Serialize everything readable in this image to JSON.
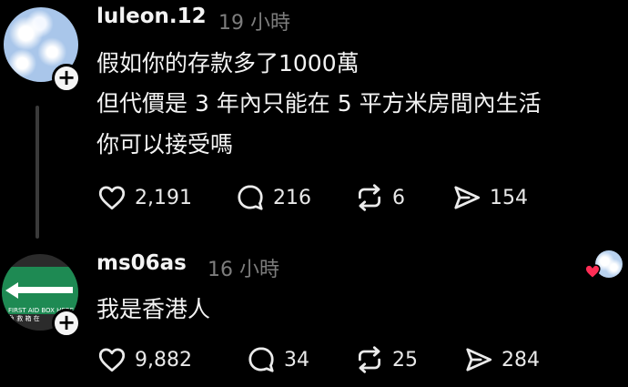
{
  "post": {
    "username": "luleon.12",
    "time": "19 小時",
    "lines": [
      "假如你的存款多了1000萬",
      "但代價是 3 年內只能在 5 平方米房間內生活",
      "你可以接受嗎"
    ],
    "likes": "2,191",
    "comments": "216",
    "reposts": "6",
    "shares": "154"
  },
  "reply": {
    "username": "ms06as",
    "time": "16 小時",
    "text": "我是香港人",
    "likes": "9,882",
    "comments": "34",
    "reposts": "25",
    "shares": "284",
    "avatar_sign_line1": "FIRST AID BOX HERE",
    "avatar_sign_line2": "急 救 箱 在"
  },
  "icons": {
    "like": "heart-icon",
    "comment": "comment-bubble-icon",
    "repost": "repost-icon",
    "share": "send-icon",
    "follow": "plus-icon"
  },
  "colors": {
    "background": "#000000",
    "text": "#f3f3f3",
    "muted": "#7d7d7d",
    "liked_heart": "#ff2d55"
  }
}
